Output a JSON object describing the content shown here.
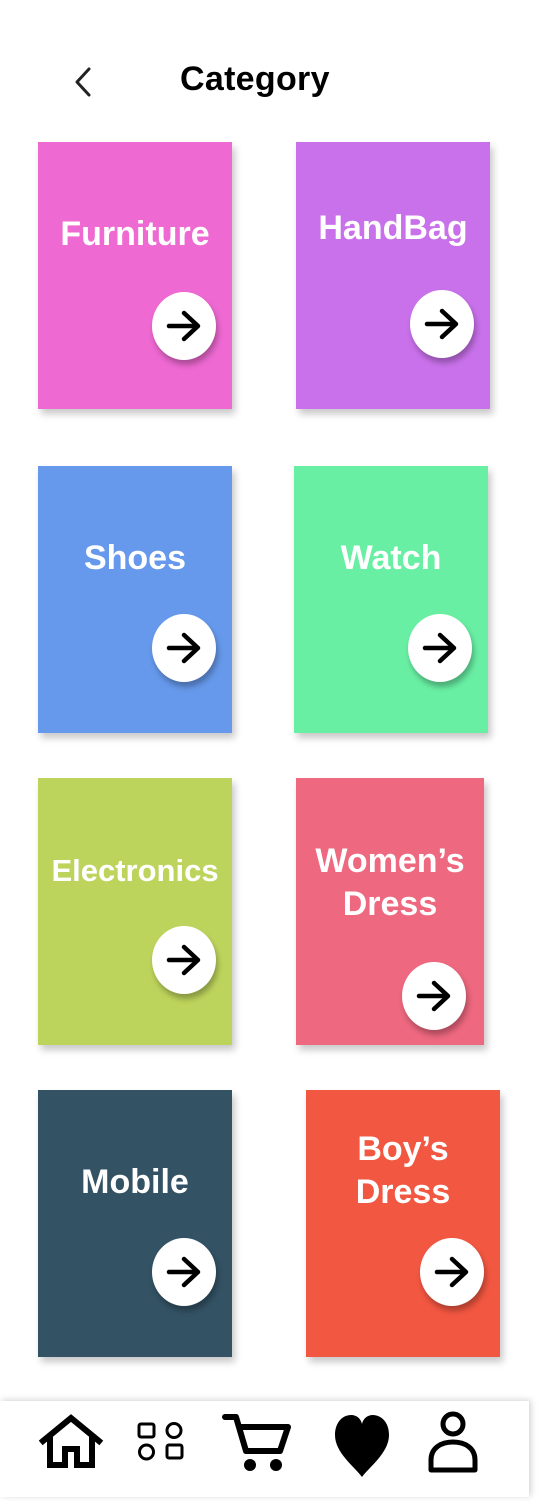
{
  "header": {
    "title": "Category",
    "back_icon": "chevron-left-icon"
  },
  "categories": [
    {
      "label": "Furniture",
      "color": "#EE69D2"
    },
    {
      "label": "HandBag",
      "color": "#C971EB"
    },
    {
      "label": "Shoes",
      "color": "#6699EB"
    },
    {
      "label": "Watch",
      "color": "#69EFA4"
    },
    {
      "label": "Electronics",
      "color": "#BDD45C"
    },
    {
      "label": "Women’s\nDress",
      "color": "#EE687F"
    },
    {
      "label": "Mobile",
      "color": "#335264"
    },
    {
      "label": "Boy’s\nDress",
      "color": "#F25741"
    }
  ],
  "tabbar": {
    "items": [
      {
        "icon": "home-icon"
      },
      {
        "icon": "categories-icon"
      },
      {
        "icon": "cart-icon"
      },
      {
        "icon": "heart-icon"
      },
      {
        "icon": "profile-icon"
      }
    ]
  }
}
